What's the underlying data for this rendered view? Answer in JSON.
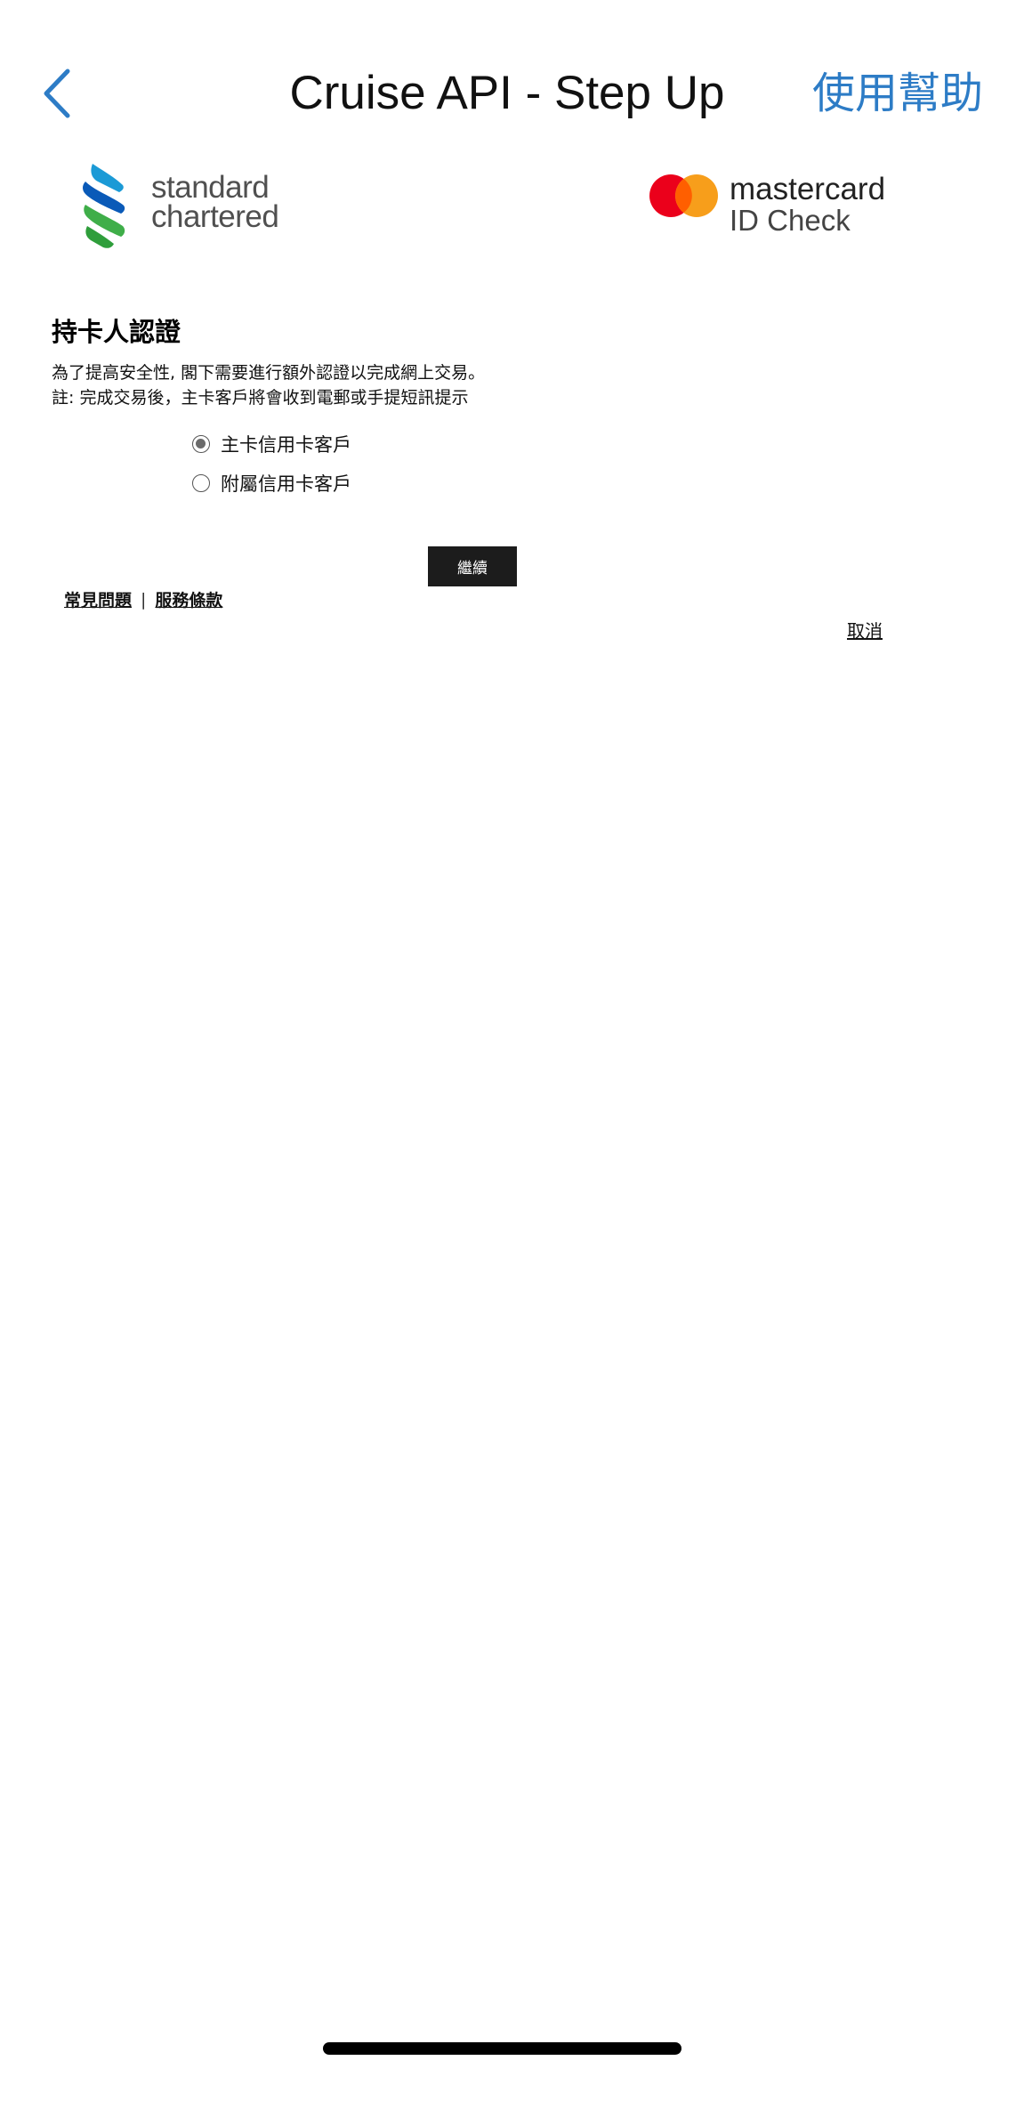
{
  "nav": {
    "title": "Cruise API - Step Up",
    "help_label": "使用幫助",
    "accent_color": "#2d7cc6",
    "back_icon": "chevron-left-icon"
  },
  "logos": {
    "bank": {
      "line1": "standard",
      "line2": "chartered"
    },
    "card": {
      "name": "mastercard",
      "sub": "ID Check"
    }
  },
  "content": {
    "heading": "持卡人認證",
    "desc_line1": "為了提高安全性, 閣下需要進行額外認證以完成網上交易。",
    "desc_line2": "註: 完成交易後，主卡客戶將會收到電郵或手提短訊提示",
    "options": [
      {
        "label": "主卡信用卡客戶",
        "selected": true
      },
      {
        "label": "附屬信用卡客戶",
        "selected": false
      }
    ],
    "continue_label": "繼續"
  },
  "footer": {
    "faq_label": "常見問題",
    "separator": "|",
    "terms_label": "服務條款",
    "cancel_label": "取消"
  }
}
